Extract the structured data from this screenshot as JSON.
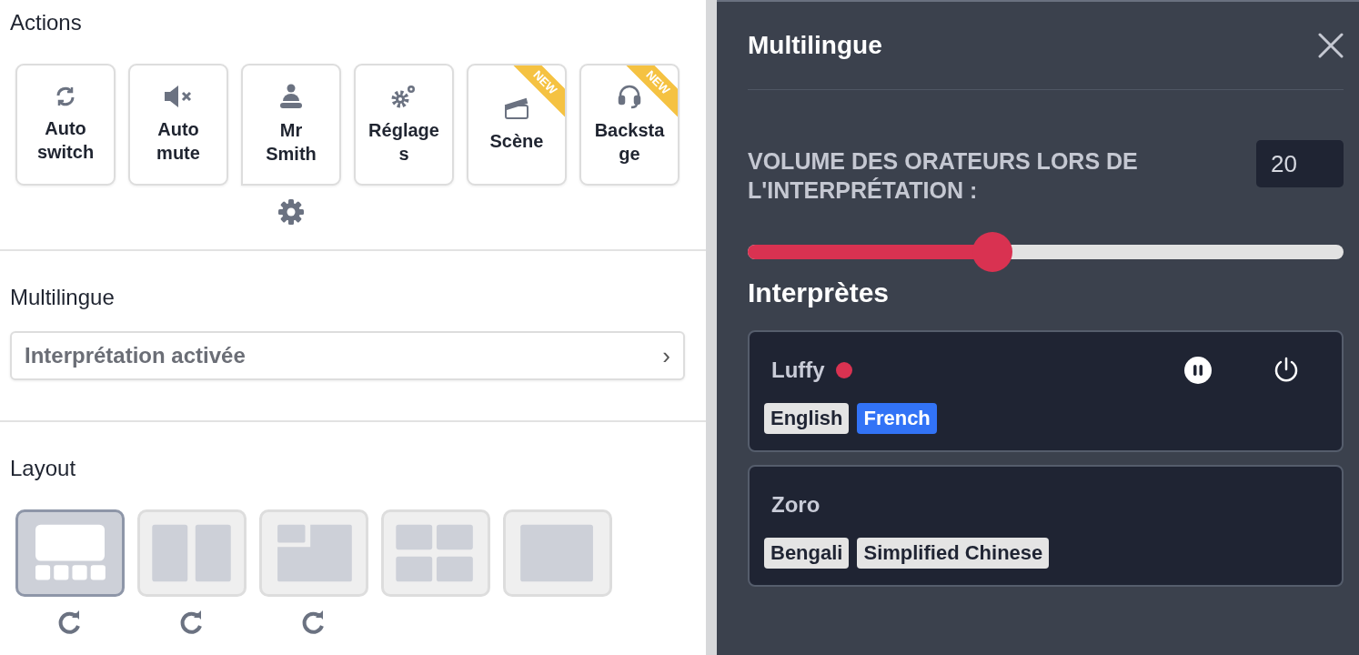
{
  "actions": {
    "title": "Actions",
    "buttons": [
      {
        "label": "Auto switch",
        "settings": false
      },
      {
        "label": "Auto mute",
        "settings": false
      },
      {
        "label": "Mr Smith",
        "settings": true
      },
      {
        "label": "Réglages",
        "settings": false
      },
      {
        "label": "Scène",
        "badge": "NEW",
        "settings": false
      },
      {
        "label": "Backstage",
        "badge": "NEW",
        "settings": false
      }
    ]
  },
  "multilingual": {
    "title": "Multilingue",
    "row": {
      "label": "Interprétation activée",
      "chevron": "›"
    }
  },
  "layout": {
    "title": "Layout",
    "tiles": [
      {
        "selected": true,
        "reset": true
      },
      {
        "selected": false,
        "reset": true
      },
      {
        "selected": false,
        "reset": true
      },
      {
        "selected": false,
        "reset": false
      },
      {
        "selected": false,
        "reset": false
      }
    ]
  },
  "panel": {
    "title": "Multilingue",
    "volume": {
      "label": "VOLUME DES ORATEURS LORS DE L'INTERPRÉTATION :",
      "value": "20",
      "level": 0.41
    },
    "interpreters_title": "Interprètes",
    "interpreters": [
      {
        "name": "Luffy",
        "live": true,
        "color": "#d93251",
        "controls": true,
        "languages": [
          {
            "label": "English",
            "selected": false
          },
          {
            "label": "French",
            "selected": true
          }
        ]
      },
      {
        "name": "Zoro",
        "live": false,
        "controls": false,
        "languages": [
          {
            "label": "Bengali",
            "selected": false
          },
          {
            "label": "Simplified Chinese",
            "selected": false
          }
        ]
      }
    ]
  }
}
